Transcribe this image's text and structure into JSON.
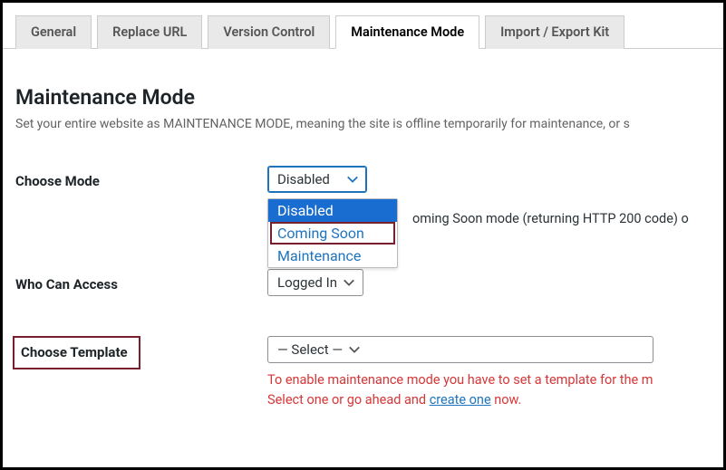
{
  "tabs": {
    "general": "General",
    "replace_url": "Replace URL",
    "version_control": "Version Control",
    "maintenance_mode": "Maintenance Mode",
    "import_export": "Import / Export Kit"
  },
  "heading": "Maintenance Mode",
  "description": "Set your entire website as MAINTENANCE MODE, meaning the site is offline temporarily for maintenance, or s",
  "choose_mode": {
    "label": "Choose Mode",
    "selected": "Disabled",
    "options": {
      "disabled": "Disabled",
      "coming_soon": "Coming Soon",
      "maintenance": "Maintenance"
    },
    "hint": "oming Soon mode (returning HTTP 200 code) o"
  },
  "who_can_access": {
    "label": "Who Can Access",
    "selected": "Logged In"
  },
  "choose_template": {
    "label": "Choose Template",
    "selected": "— Select —",
    "warn_line1": "To enable maintenance mode you have to set a template for the m",
    "warn_line2a": "Select one or go ahead and ",
    "warn_link": "create one",
    "warn_line2b": " now."
  }
}
